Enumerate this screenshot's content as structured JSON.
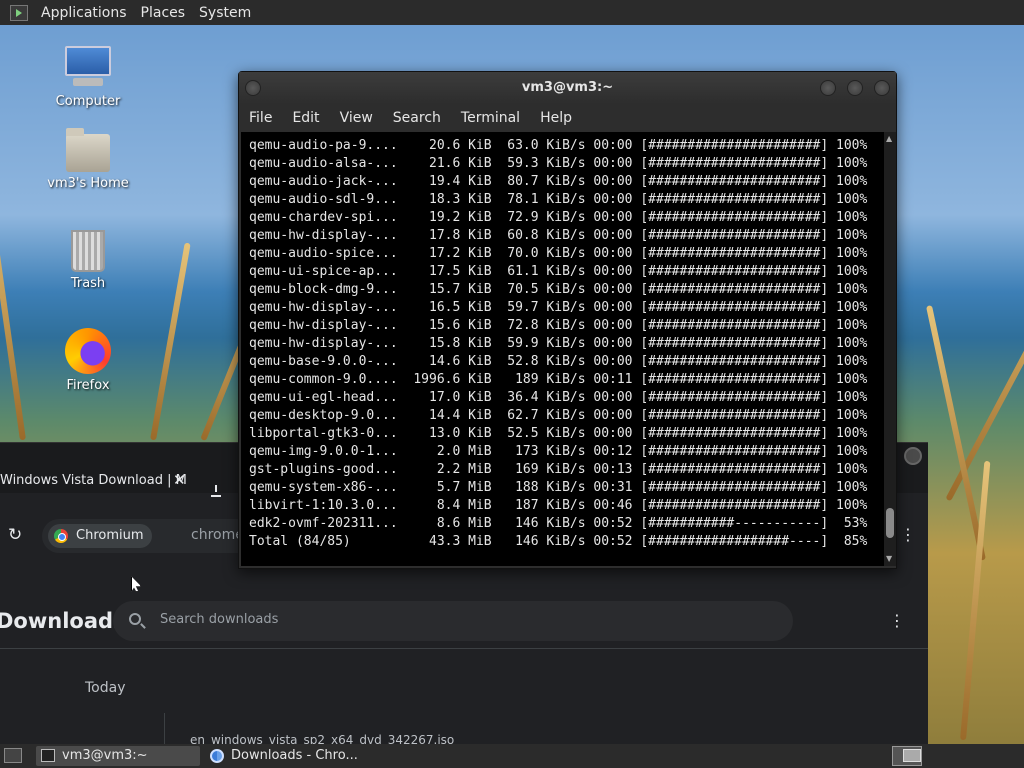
{
  "top_panel": {
    "menus": [
      "Applications",
      "Places",
      "System"
    ]
  },
  "desktop": {
    "icons": [
      {
        "label": "Computer",
        "icon": "computer-icon"
      },
      {
        "label": "vm3's Home",
        "icon": "home-folder-icon"
      },
      {
        "label": "Trash",
        "icon": "trash-icon"
      },
      {
        "label": "Firefox",
        "icon": "firefox-icon"
      }
    ]
  },
  "terminal": {
    "title": "vm3@vm3:~",
    "menus": [
      "File",
      "Edit",
      "View",
      "Search",
      "Terminal",
      "Help"
    ],
    "lines": [
      "qemu-audio-pa-9....    20.6 KiB  63.0 KiB/s 00:00 [######################] 100%",
      "qemu-audio-alsa-...    21.6 KiB  59.3 KiB/s 00:00 [######################] 100%",
      "qemu-audio-jack-...    19.4 KiB  80.7 KiB/s 00:00 [######################] 100%",
      "qemu-audio-sdl-9...    18.3 KiB  78.1 KiB/s 00:00 [######################] 100%",
      "qemu-chardev-spi...    19.2 KiB  72.9 KiB/s 00:00 [######################] 100%",
      "qemu-hw-display-...    17.8 KiB  60.8 KiB/s 00:00 [######################] 100%",
      "qemu-audio-spice...    17.2 KiB  70.0 KiB/s 00:00 [######################] 100%",
      "qemu-ui-spice-ap...    17.5 KiB  61.1 KiB/s 00:00 [######################] 100%",
      "qemu-block-dmg-9...    15.7 KiB  70.5 KiB/s 00:00 [######################] 100%",
      "qemu-hw-display-...    16.5 KiB  59.7 KiB/s 00:00 [######################] 100%",
      "qemu-hw-display-...    15.6 KiB  72.8 KiB/s 00:00 [######################] 100%",
      "qemu-hw-display-...    15.8 KiB  59.9 KiB/s 00:00 [######################] 100%",
      "qemu-base-9.0.0-...    14.6 KiB  52.8 KiB/s 00:00 [######################] 100%",
      "qemu-common-9.0....  1996.6 KiB   189 KiB/s 00:11 [######################] 100%",
      "qemu-ui-egl-head...    17.0 KiB  36.4 KiB/s 00:00 [######################] 100%",
      "qemu-desktop-9.0...    14.4 KiB  62.7 KiB/s 00:00 [######################] 100%",
      "libportal-gtk3-0...    13.0 KiB  52.5 KiB/s 00:00 [######################] 100%",
      "qemu-img-9.0.0-1...     2.0 MiB   173 KiB/s 00:12 [######################] 100%",
      "gst-plugins-good...     2.2 MiB   169 KiB/s 00:13 [######################] 100%",
      "qemu-system-x86-...     5.7 MiB   188 KiB/s 00:31 [######################] 100%",
      "libvirt-1:10.3.0...     8.4 MiB   187 KiB/s 00:46 [######################] 100%",
      "edk2-ovmf-202311...     8.6 MiB   146 KiB/s 00:52 [###########-----------]  53%",
      "Total (84/85)          43.3 MiB   146 KiB/s 00:52 [##################----]  85%"
    ]
  },
  "chromium": {
    "tab_title": "Windows Vista Download | M",
    "tab_close": "✕",
    "chip_label": "Chromium",
    "url": "chrome://dow",
    "page_title": "Downloads",
    "search_placeholder": "Search downloads",
    "more_glyph": "⋮",
    "date_heading": "Today",
    "file_name": "en_windows_vista_sp2_x64_dvd_342267.iso"
  },
  "taskbar": {
    "tasks": [
      {
        "label": "vm3@vm3:~",
        "icon": "terminal-icon",
        "active": true
      },
      {
        "label": "Downloads - Chro...",
        "icon": "chromium-icon",
        "active": false
      }
    ]
  }
}
